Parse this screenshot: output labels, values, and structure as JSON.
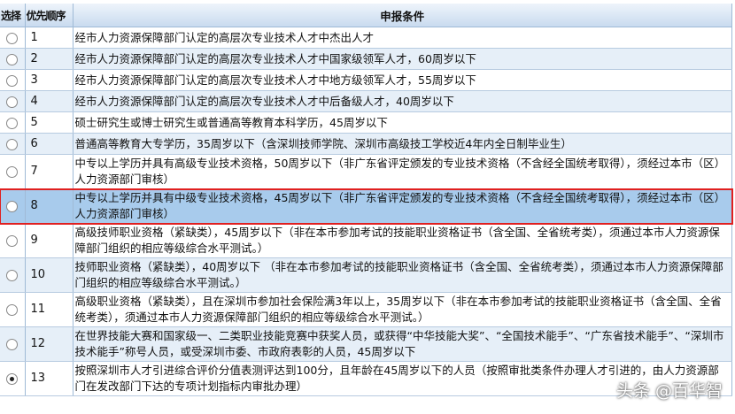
{
  "header": {
    "select": "选择",
    "order": "优先顺序",
    "condition": "申报条件"
  },
  "rows": [
    {
      "order": "1",
      "text": "经市人力资源保障部门认定的高层次专业技术人才中杰出人才",
      "selected": false
    },
    {
      "order": "2",
      "text": "经市人力资源保障部门认定的高层次专业技术人才中国家级领军人才，60周岁以下",
      "selected": false
    },
    {
      "order": "3",
      "text": "经市人力资源保障部门认定的高层次专业技术人才中地方级领军人才，55周岁以下",
      "selected": false
    },
    {
      "order": "4",
      "text": "经市人力资源保障部门认定的高层次专业技术人才中后备级人才，40周岁以下",
      "selected": false
    },
    {
      "order": "5",
      "text": "硕士研究生或博士研究生或普通高等教育本科学历，45周岁以下",
      "selected": false
    },
    {
      "order": "6",
      "text": "普通高等教育大专学历，35周岁以下（含深圳技师学院、深圳市高级技工学校近4年内全日制毕业生）",
      "selected": false
    },
    {
      "order": "7",
      "text": "中专以上学历并具有高级专业技术资格，50周岁以下（非广东省评定颁发的专业技术资格（不含经全国统考取得），须经过本市（区）人力资源部门审核）",
      "selected": false
    },
    {
      "order": "8",
      "text": "中专以上学历并具有中级专业技术资格，45周岁以下（非广东省评定颁发的专业技术资格（不含经全国统考取得），须经过本市（区）人力资源部门审核）",
      "selected": false
    },
    {
      "order": "9",
      "text": "高级技师职业资格（紧缺类），45周岁以下（非在本市参加考试的技能职业资格证书（含全国、全省统考类），须通过本市人力资源保障部门组织的相应等级综合水平测试。）",
      "selected": false
    },
    {
      "order": "10",
      "text": "技师职业资格（紧缺类），40周岁以下 （非在本市参加考试的技能职业资格证书（含全国、全省统考类），须通过本市人力资源保障部门组织的相应等级综合水平测试。）",
      "selected": false
    },
    {
      "order": "11",
      "text": "高级职业资格（紧缺类），且在深圳市参加社会保险满3年以上，35周岁以下（非在本市参加考试的技能职业资格证书（含全国、全省统考类），须通过本市人力资源保障部门组织的相应等级综合水平测试。）",
      "selected": false
    },
    {
      "order": "12",
      "text": "在世界技能大赛和国家级一、二类职业技能竞赛中获奖人员，或获得“中华技能大奖”、“全国技术能手”、“广东省技术能手”、“深圳市技术能手”称号人员，或受深圳市委、市政府表彰的人员，45周岁以下",
      "selected": false
    },
    {
      "order": "13",
      "text": "按照深圳市人才引进综合评价分值表测评达到100分，且年龄在45周岁以下的人员（按照审批类条件办理人才引进的，由人力资源部门在发改部门下达的专项计划指标内审批办理）",
      "selected": true
    }
  ],
  "watermark": "头条 @百华智"
}
